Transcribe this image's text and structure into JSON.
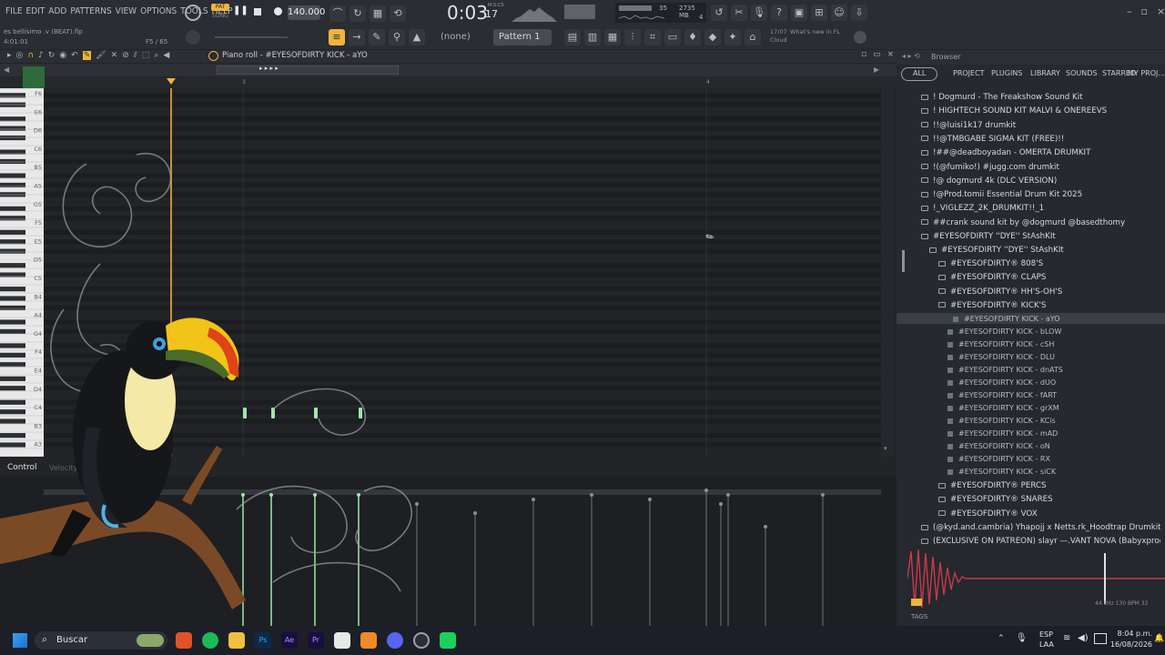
{
  "menubar": {
    "items": [
      "FILE",
      "EDIT",
      "ADD",
      "PATTERNS",
      "VIEW",
      "OPTIONS",
      "TOOLS",
      "HELP"
    ],
    "project_file": "es bellísimo .v (BEAT).flp",
    "position": "4:01:01",
    "note_info": "F5 / 65",
    "pat_label": "PAT",
    "song_label": "SONG",
    "tempo": "140.000",
    "time": "0:03",
    "time_frac": "17",
    "time_unit": "M:S:CS",
    "memory": "2735 MB",
    "cpu_a": "35",
    "cpu_b": "4"
  },
  "toolbar": {
    "none_label": "(none)",
    "pattern_label": "Pattern 1",
    "news_date": "17/07",
    "news_text": "What's new in FL Cloud"
  },
  "pianoroll": {
    "title": "Piano roll - #EYESOFDIRTY KICK - aYO",
    "ruler_marks": [
      "3",
      "4"
    ],
    "key_labels": [
      "F6",
      "E6",
      "D6",
      "C6",
      "B5",
      "A5",
      "G5",
      "F5",
      "E5",
      "D5",
      "C5",
      "B4",
      "A4",
      "G4",
      "F4",
      "E4",
      "D4",
      "C4",
      "B3",
      "A3"
    ]
  },
  "control": {
    "label": "Control",
    "sub_label": "Velocity"
  },
  "browser": {
    "title": "Browser",
    "tabs": [
      "ALL",
      "PROJECT",
      "PLUGINS",
      "LIBRARY",
      "SOUNDS",
      "STARRED",
      "MY PROJ..."
    ],
    "items": [
      "! Dogmurd - The Freakshow Sound Kit",
      "! HIGHTECH SOUND KIT MALVI & ONEREEVS",
      "!!@luisi1k17 drumkit",
      "!!@TMBGABE SIGMA KIT (FREE)!!",
      "!##@deadboyadan - OMERTA DRUMKIT",
      "!(@fumiko!) #jugg.com drumkit",
      "!@ dogmurd 4k (DLC VERSION)",
      "!@Prod.tomii Essential Drum Kit 2025",
      "!_VIGLEZZ_2K_DRUMKIT!!_1",
      "##crank sound kit by @dogmurd @basedthomy",
      "#EYESOFDIRTY ''DYE'' StAshKIt",
      "#EYESOFDIRTY ''DYE'' StAshKIt",
      "#EYESOFDIRTY® 808'S",
      "#EYESOFDIRTY® CLAPS",
      "#EYESOFDIRTY® HH'S-OH'S",
      "#EYESOFDIRTY® KICK'S",
      "#EYESOFDIRTY KICK - aYO",
      "#EYESOFDIRTY KICK - bLOW",
      "#EYESOFDIRTY KICK - cSH",
      "#EYESOFDIRTY KICK - DLU",
      "#EYESOFDIRTY KICK - dnATS",
      "#EYESOFDIRTY KICK - dUO",
      "#EYESOFDIRTY KICK - fART",
      "#EYESOFDIRTY KICK - grXM",
      "#EYESOFDIRTY KICK - KCis",
      "#EYESOFDIRTY KICK - mAD",
      "#EYESOFDIRTY KICK - oN",
      "#EYESOFDIRTY KICK - RX",
      "#EYESOFDIRTY KICK - siCK",
      "#EYESOFDIRTY® PERCS",
      "#EYESOFDIRTY® SNARES",
      "#EYESOFDIRTY® VOX",
      "(@kyd.and.cambria) Yhapojj x Netts.rk_Hoodtrap Drumkit (Rare Shit)",
      "(EXCLUSIVE ON PATREON) slayr —.VANT NOVA (Babyxprod Bangtozzy)"
    ],
    "wave_info": "44 kHz 130 BPM 32",
    "tags_label": "TAGS"
  },
  "taskbar": {
    "search_placeholder": "Buscar",
    "lang": "ESP",
    "lang_sub": "LAA",
    "clock_time": "8:04 p.m.",
    "clock_date": "16/08/2026"
  },
  "colors": {
    "accent_orange": "#f0b43c",
    "note_green": "#9fe8a5",
    "selection": "#3a3f45"
  }
}
